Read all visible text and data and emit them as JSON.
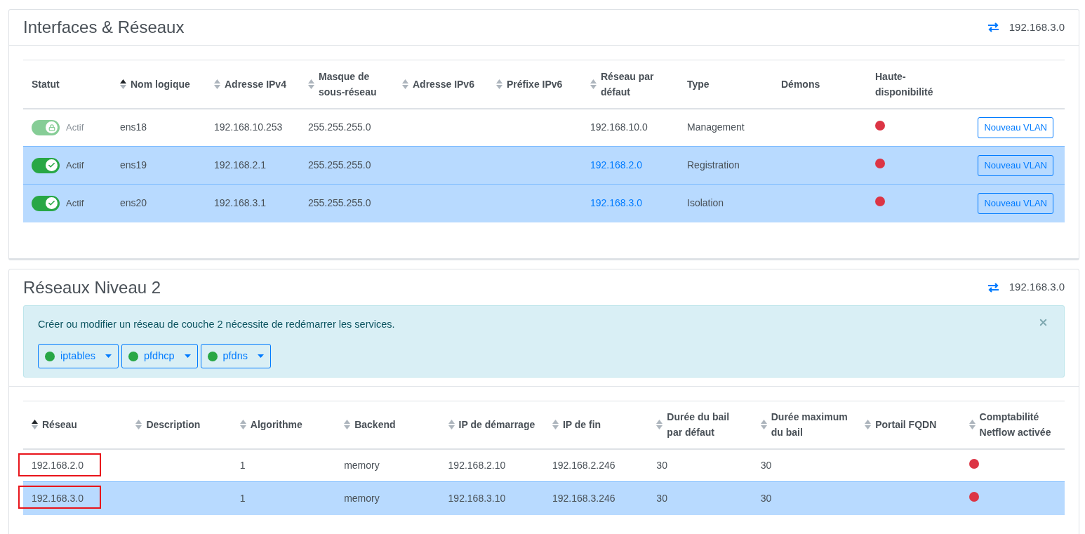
{
  "interfaces": {
    "title": "Interfaces & Réseaux",
    "network": "192.168.3.0",
    "columns": [
      {
        "label": "Statut"
      },
      {
        "label": "Nom logique",
        "sorted": true
      },
      {
        "label": "Adresse IPv4",
        "sorted": false
      },
      {
        "label": "Masque de sous-réseau",
        "sorted": false
      },
      {
        "label": "Adresse IPv6",
        "sorted": false
      },
      {
        "label": "Préfixe IPv6",
        "sorted": false
      },
      {
        "label": "Réseau par défaut",
        "sorted": false
      },
      {
        "label": "Type"
      },
      {
        "label": "Démons"
      },
      {
        "label": "Haute-disponibilité"
      }
    ],
    "rows": [
      {
        "selected": false,
        "status": {
          "kind": "locked",
          "label": "Actif"
        },
        "name": "ens18",
        "ipv4": "192.168.10.253",
        "mask": "255.255.255.0",
        "network": {
          "text": "192.168.10.0",
          "link": false
        },
        "type": "Management",
        "ha_enabled": false,
        "action": "Nouveau VLAN"
      },
      {
        "selected": true,
        "status": {
          "kind": "on",
          "label": "Actif"
        },
        "name": "ens19",
        "ipv4": "192.168.2.1",
        "mask": "255.255.255.0",
        "network": {
          "text": "192.168.2.0",
          "link": true
        },
        "type": "Registration",
        "ha_enabled": false,
        "action": "Nouveau VLAN"
      },
      {
        "selected": true,
        "status": {
          "kind": "on",
          "label": "Actif"
        },
        "name": "ens20",
        "ipv4": "192.168.3.1",
        "mask": "255.255.255.0",
        "network": {
          "text": "192.168.3.0",
          "link": true
        },
        "type": "Isolation",
        "ha_enabled": false,
        "action": "Nouveau VLAN"
      }
    ]
  },
  "layer2": {
    "title": "Réseaux Niveau 2",
    "network": "192.168.3.0",
    "alert": {
      "message": "Créer ou modifier un réseau de couche 2 nécessite de redémarrer les services.",
      "services": [
        {
          "name": "iptables",
          "running": true
        },
        {
          "name": "pfdhcp",
          "running": true
        },
        {
          "name": "pfdns",
          "running": true
        }
      ]
    },
    "columns": [
      {
        "label": "Réseau",
        "sorted": true
      },
      {
        "label": "Description",
        "sorted": false
      },
      {
        "label": "Algorithme",
        "sorted": false
      },
      {
        "label": "Backend",
        "sorted": false
      },
      {
        "label": "IP de démarrage",
        "sorted": false
      },
      {
        "label": "IP de fin",
        "sorted": false
      },
      {
        "label": "Durée du bail par défaut",
        "sorted": false
      },
      {
        "label": "Durée maximum du bail",
        "sorted": false
      },
      {
        "label": "Portail FQDN",
        "sorted": false
      },
      {
        "label": "Comptabilité Netflow activée",
        "sorted": false
      }
    ],
    "rows": [
      {
        "selected": false,
        "highlighted": true,
        "network": "192.168.2.0",
        "algorithm": "1",
        "backend": "memory",
        "start": "192.168.2.10",
        "end": "192.168.2.246",
        "lease": "30",
        "max_lease": "30",
        "netflow_enabled": false
      },
      {
        "selected": true,
        "highlighted": true,
        "network": "192.168.3.0",
        "algorithm": "1",
        "backend": "memory",
        "start": "192.168.3.10",
        "end": "192.168.3.246",
        "lease": "30",
        "max_lease": "30",
        "netflow_enabled": false
      }
    ]
  }
}
